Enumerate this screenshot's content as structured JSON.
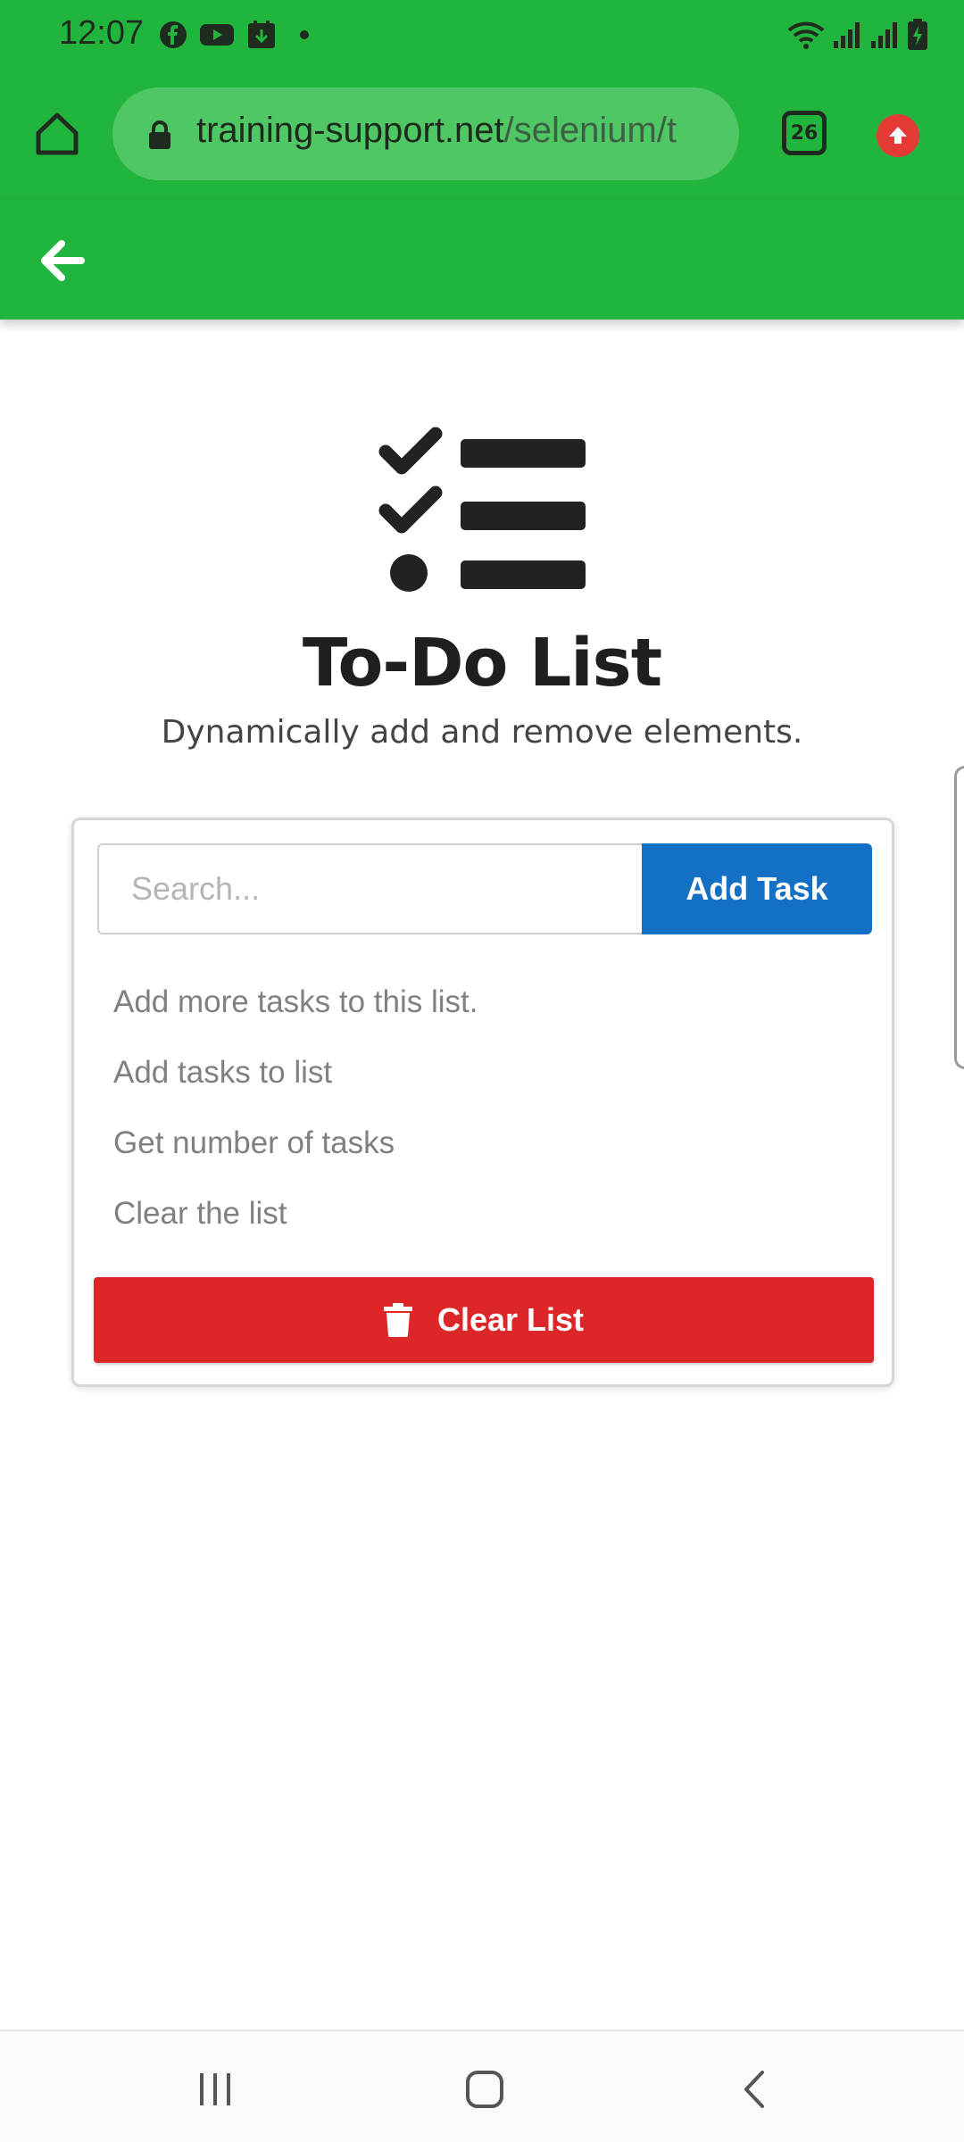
{
  "status_bar": {
    "time": "12:07",
    "notification_icons": [
      "facebook-icon",
      "youtube-icon",
      "download-app-icon"
    ],
    "system_icons": [
      "wifi-icon",
      "signal-icon",
      "signal-icon",
      "battery-charging-icon"
    ]
  },
  "browser": {
    "url_domain": "training-support.net",
    "url_path": "/selenium/t",
    "tab_count": "26"
  },
  "header": {
    "back_icon": "arrow-left-icon"
  },
  "page": {
    "title": "To-Do List",
    "subtitle": "Dynamically add and remove elements."
  },
  "todo": {
    "search_placeholder": "Search...",
    "add_button_label": "Add Task",
    "tasks": [
      "Add more tasks to this list.",
      "Add tasks to list",
      "Get number of tasks",
      "Clear the list"
    ],
    "clear_button_label": "Clear List"
  },
  "colors": {
    "toolbar_green": "#22b53d",
    "add_button_blue": "#1370c4",
    "clear_button_red": "#dc2628"
  }
}
